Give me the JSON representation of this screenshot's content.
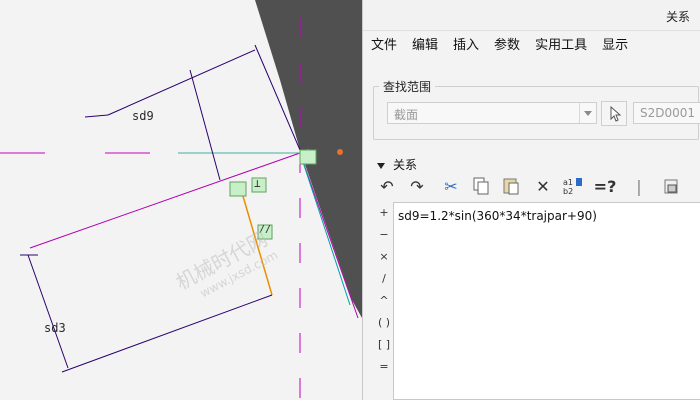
{
  "canvas": {
    "dim_labels": [
      "sd9",
      "sd3"
    ],
    "constraint_symbols": {
      "perpendicular": "⊥",
      "parallel": "//"
    },
    "watermark": {
      "main": "机械时代网",
      "sub": "www.jxsd.com"
    },
    "colors": {
      "dark_area": "#505050",
      "construction": "#b000b0",
      "geometry": "#e89000",
      "dimension": "#2c006e",
      "axis": "#00a0a0"
    }
  },
  "panel": {
    "title": "关系",
    "menu": [
      "文件",
      "编辑",
      "插入",
      "参数",
      "实用工具",
      "显示"
    ],
    "search_group": {
      "label": "查找范围",
      "scope_value": "截面",
      "select_icon": "cursor-icon",
      "id_value": "S2D0001"
    },
    "relations": {
      "header": "关系",
      "toolbar_icons": [
        "undo-icon",
        "redo-icon",
        "cut-icon",
        "copy-icon",
        "paste-icon",
        "delete-icon",
        "sort-icon",
        "evaluate-icon",
        "measure-icon",
        "lock-icon"
      ],
      "operators": [
        "+",
        "−",
        "×",
        "/",
        "^",
        "( )",
        "[ ]",
        "="
      ],
      "text": "sd9=1.2*sin(360*34*trajpar+90)"
    }
  }
}
